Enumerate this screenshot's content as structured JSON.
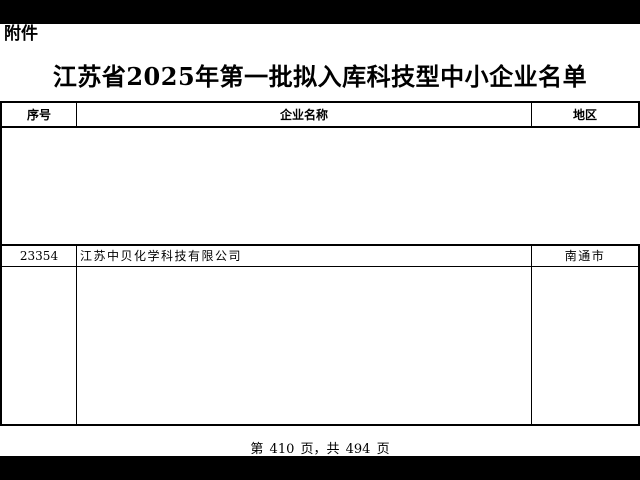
{
  "attachment_label": "附件",
  "title": "江苏省2025年第一批拟入库科技型中小企业名单",
  "table": {
    "headers": {
      "serial": "序号",
      "company": "企业名称",
      "region": "地区"
    },
    "rows": [
      {
        "serial": "23354",
        "company": "江苏中贝化学科技有限公司",
        "region": "南通市"
      }
    ]
  },
  "footer": "第 410 页，共 494 页"
}
